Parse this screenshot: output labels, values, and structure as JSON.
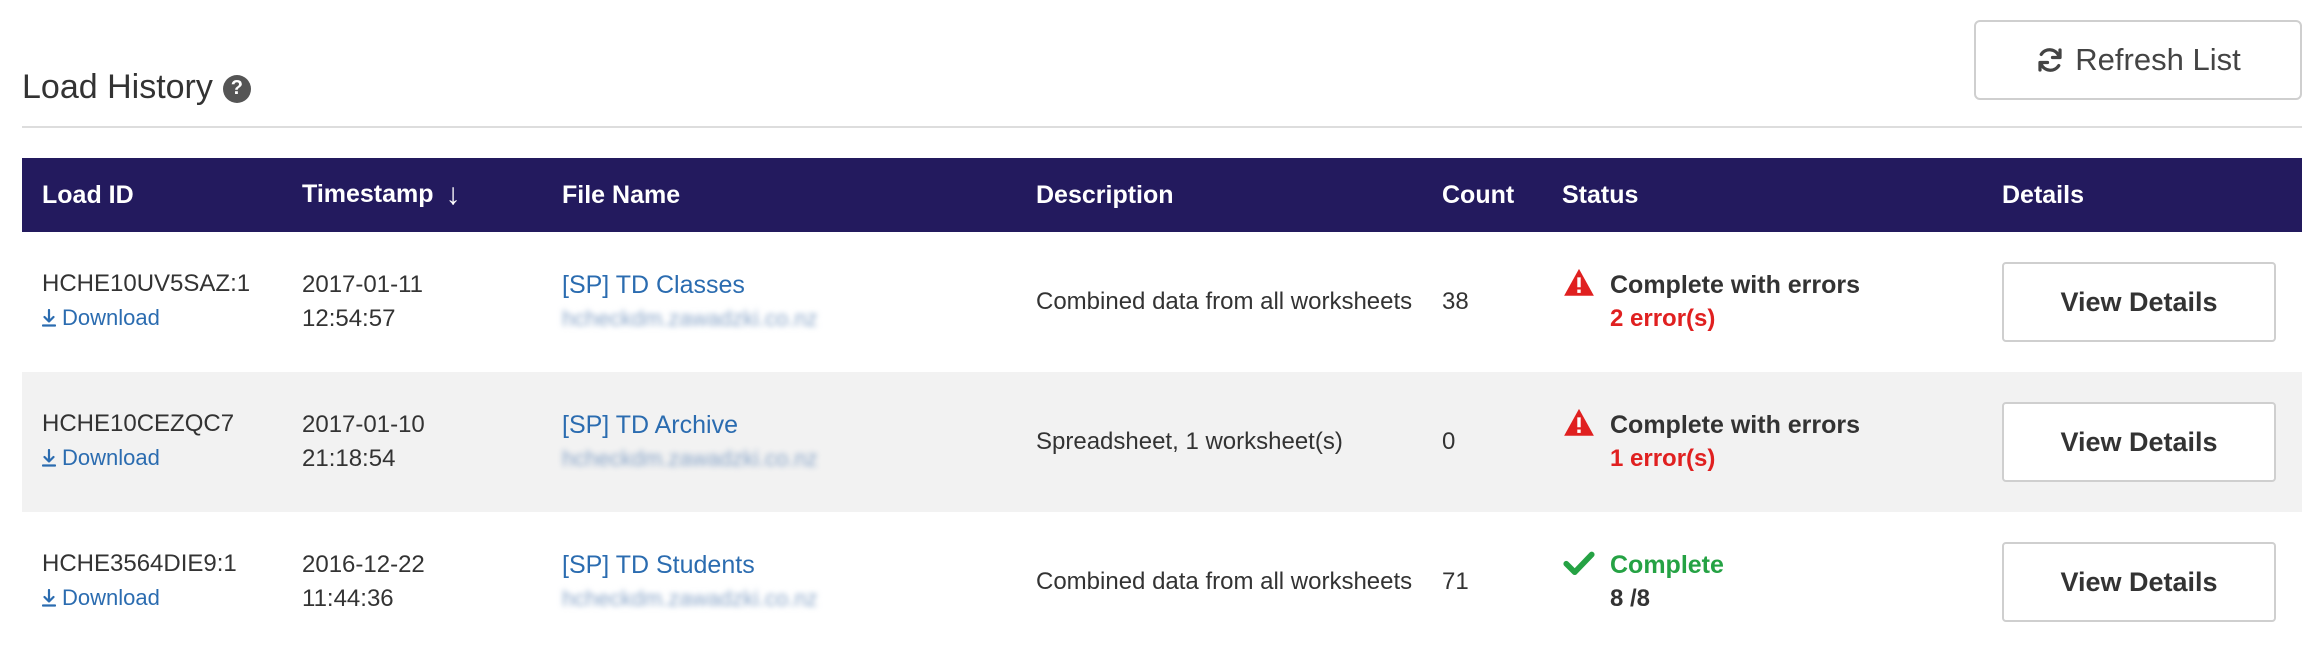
{
  "header": {
    "title": "Load History",
    "help_icon": "question-circle-icon",
    "refresh_label": "Refresh List",
    "refresh_icon": "refresh-icon"
  },
  "table": {
    "columns": [
      "Load ID",
      "Timestamp",
      "File Name",
      "Description",
      "Count",
      "Status",
      "Details"
    ],
    "sort_indicator": "↓",
    "rows": [
      {
        "load_id": "HCHE10UV5SAZ:1",
        "download_label": "Download",
        "date": "2017-01-11",
        "time": "12:54:57",
        "file_name": "[SP] TD Classes",
        "file_email": "hcheckdm.zawadzki.co.nz",
        "description": "Combined data from all worksheets",
        "count": "38",
        "status_title": "Complete with errors",
        "status_detail": "2 error(s)",
        "status_type": "error",
        "details_label": "View Details"
      },
      {
        "load_id": "HCHE10CEZQC7",
        "download_label": "Download",
        "date": "2017-01-10",
        "time": "21:18:54",
        "file_name": "[SP] TD Archive",
        "file_email": "hcheckdm.zawadzki.co.nz",
        "description": "Spreadsheet, 1 worksheet(s)",
        "count": "0",
        "status_title": "Complete with errors",
        "status_detail": "1 error(s)",
        "status_type": "error",
        "details_label": "View Details"
      },
      {
        "load_id": "HCHE3564DIE9:1",
        "download_label": "Download",
        "date": "2016-12-22",
        "time": "11:44:36",
        "file_name": "[SP] TD Students",
        "file_email": "hcheckdm.zawadzki.co.nz",
        "description": "Combined data from all worksheets",
        "count": "71",
        "status_title": "Complete",
        "status_detail": "8 /8",
        "status_type": "ok",
        "details_label": "View Details"
      }
    ]
  },
  "colors": {
    "header_bg": "#231a5e",
    "link": "#2b6cb0",
    "error": "#e02020",
    "success": "#25a244"
  }
}
